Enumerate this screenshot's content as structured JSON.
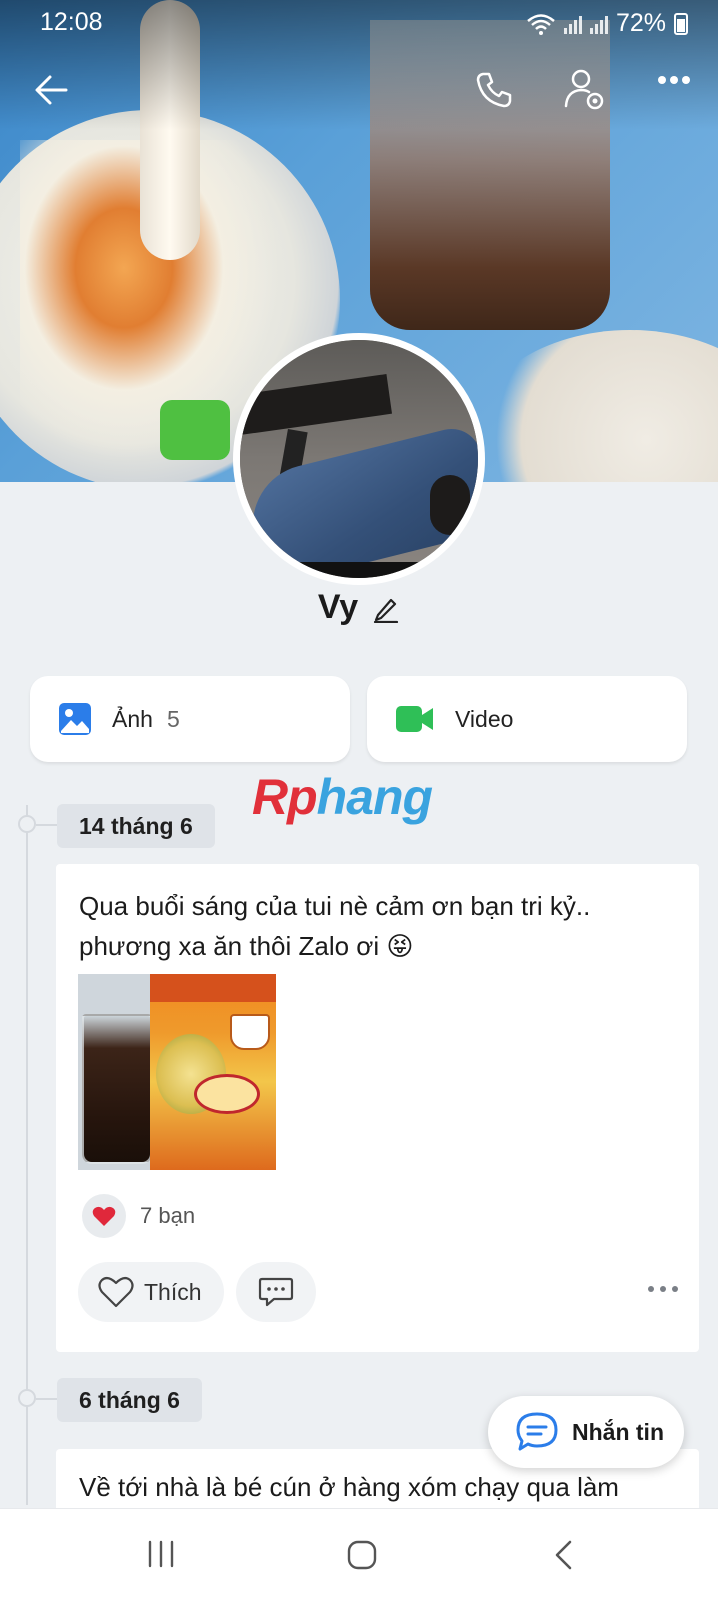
{
  "status_bar": {
    "time": "12:08",
    "battery": "72%"
  },
  "profile": {
    "name": "Vy"
  },
  "media": {
    "photos_label": "Ảnh",
    "photos_count": "5",
    "video_label": "Video"
  },
  "watermark": {
    "part1": "Rp",
    "part2": "hang"
  },
  "timeline": {
    "posts": [
      {
        "date": "14 tháng 6",
        "text": "Qua buổi sáng của tui nè cảm ơn bạn tri kỷ.. phương xa ăn thôi Zalo ơi 😝",
        "reactions": "7 bạn",
        "like_label": "Thích"
      },
      {
        "date": "6 tháng 6",
        "text": "Về tới nhà là bé cún ở hàng xóm chạy qua làm"
      }
    ]
  },
  "fab": {
    "label": "Nhắn tin"
  },
  "colors": {
    "accent": "#2b7de9",
    "video_green": "#2fbf57",
    "heart_red": "#e0283b"
  }
}
